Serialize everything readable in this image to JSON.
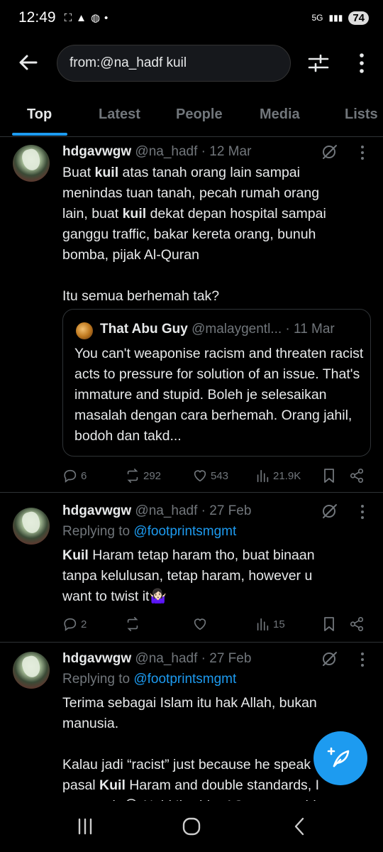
{
  "status": {
    "time": "12:49",
    "battery": "74",
    "network": "5G"
  },
  "search": {
    "query": "from:@na_hadf kuil"
  },
  "tabs": [
    "Top",
    "Latest",
    "People",
    "Media",
    "Lists"
  ],
  "colors": {
    "accent": "#1d9bf0",
    "background": "#000000",
    "muted": "#71767b"
  },
  "tweets": [
    {
      "name": "hdgavwgw",
      "handle": "@na_hadf",
      "date": "12 Mar",
      "body_html": "Buat <b>kuil</b> atas tanah orang lain sampai<br>menindas tuan tanah, pecah rumah orang<br>lain, buat <b>kuil</b> dekat depan hospital sampai<br>ganggu traffic, bakar kereta orang, bunuh<br>bomba, pijak Al-Quran<br><br>Itu semua berhemah tak?",
      "quote": {
        "name": "That Abu Guy",
        "handle": "@malaygentl...",
        "date": "11 Mar",
        "text": "You can't weaponise racism and threaten racist acts to pressure for solution of an issue. That's immature and stupid. Boleh je selesaikan masalah dengan cara berhemah. Orang jahil, bodoh dan takd..."
      },
      "replies": "6",
      "reposts": "292",
      "likes": "543",
      "views": "21.9K"
    },
    {
      "name": "hdgavwgw",
      "handle": "@na_hadf",
      "date": "27 Feb",
      "replying_label": "Replying to",
      "replying_to": "@footprintsmgmt",
      "body_html": "<b>Kuil</b> Haram tetap haram tho, buat binaan<br>tanpa kelulusan, tetap haram, however u<br>want to twist it🤷🏻‍♀️",
      "replies": "2",
      "reposts": "",
      "likes": "",
      "views": "15"
    },
    {
      "name": "hdgavwgw",
      "handle": "@na_hadf",
      "date": "27 Feb",
      "replying_label": "Replying to",
      "replying_to": "@footprintsmgmt",
      "body_html": "Terima sebagai Islam itu hak Allah, bukan<br>manusia.<br><br>Kalau jadi “racist” just because he speak<br>pasal <b>Kuil</b> Haram and double standards, I<br>support je😭 Nabi Ibrahim AS pun runtuhkan"
    }
  ],
  "icons": {
    "back": "arrow-left-icon",
    "filter": "sliders-icon",
    "more": "vertical-dots-icon",
    "grok": "grok-icon",
    "compose": "feather-plus-icon"
  }
}
